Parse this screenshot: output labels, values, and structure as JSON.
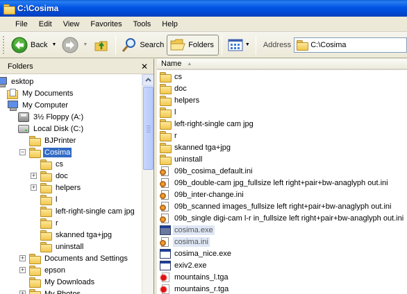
{
  "window": {
    "title": "C:\\Cosima"
  },
  "menu": [
    "File",
    "Edit",
    "View",
    "Favorites",
    "Tools",
    "Help"
  ],
  "toolbar": {
    "back_label": "Back",
    "search_label": "Search",
    "folders_label": "Folders",
    "address_label": "Address",
    "address_value": "C:\\Cosima"
  },
  "folders_pane": {
    "title": "Folders",
    "tree": [
      {
        "label": "esktop",
        "icon": "desktop-icon",
        "expander": "",
        "selected": false
      },
      {
        "label": "My Documents",
        "icon": "my-documents-icon",
        "expander": "",
        "selected": false
      },
      {
        "label": "My Computer",
        "icon": "my-computer-icon",
        "expander": "",
        "selected": false
      },
      {
        "label": "3½ Floppy (A:)",
        "icon": "floppy-drive-icon",
        "expander": "",
        "selected": false
      },
      {
        "label": "Local Disk (C:)",
        "icon": "hard-drive-icon",
        "expander": "",
        "selected": false
      },
      {
        "label": "BJPrinter",
        "icon": "folder-icon",
        "expander": "",
        "selected": false
      },
      {
        "label": "Cosima",
        "icon": "folder-open-icon",
        "expander": "−",
        "selected": true
      },
      {
        "label": "cs",
        "icon": "folder-icon",
        "expander": "",
        "selected": false
      },
      {
        "label": "doc",
        "icon": "folder-icon",
        "expander": "+",
        "selected": false
      },
      {
        "label": "helpers",
        "icon": "folder-icon",
        "expander": "+",
        "selected": false
      },
      {
        "label": "l",
        "icon": "folder-icon",
        "expander": "",
        "selected": false
      },
      {
        "label": "left-right-single cam jpg",
        "icon": "folder-icon",
        "expander": "",
        "selected": false
      },
      {
        "label": "r",
        "icon": "folder-icon",
        "expander": "",
        "selected": false
      },
      {
        "label": "skanned tga+jpg",
        "icon": "folder-icon",
        "expander": "",
        "selected": false
      },
      {
        "label": "uninstall",
        "icon": "folder-icon",
        "expander": "",
        "selected": false
      },
      {
        "label": "Documents and Settings",
        "icon": "folder-icon",
        "expander": "+",
        "selected": false
      },
      {
        "label": "epson",
        "icon": "folder-icon",
        "expander": "+",
        "selected": false
      },
      {
        "label": "My Downloads",
        "icon": "folder-icon",
        "expander": "",
        "selected": false
      },
      {
        "label": "My Photos",
        "icon": "folder-icon",
        "expander": "+",
        "selected": false
      }
    ]
  },
  "file_list": {
    "column_name": "Name",
    "files": [
      {
        "name": "cs",
        "type": "folder"
      },
      {
        "name": "doc",
        "type": "folder"
      },
      {
        "name": "helpers",
        "type": "folder"
      },
      {
        "name": "l",
        "type": "folder"
      },
      {
        "name": "left-right-single cam jpg",
        "type": "folder"
      },
      {
        "name": "r",
        "type": "folder"
      },
      {
        "name": "skanned tga+jpg",
        "type": "folder"
      },
      {
        "name": "uninstall",
        "type": "folder"
      },
      {
        "name": "09b_cosima_default.ini",
        "type": "ini"
      },
      {
        "name": "09b_double-cam jpg_fullsize left right+pair+bw-anaglyph out.ini",
        "type": "ini"
      },
      {
        "name": "09b_inter-change.ini",
        "type": "ini"
      },
      {
        "name": "09b_scanned images_fullsize left right+pair+bw-anaglyph out.ini",
        "type": "ini"
      },
      {
        "name": "09b_single digi-cam l-r in_fullsize left right+pair+bw-anaglyph out.ini",
        "type": "ini"
      },
      {
        "name": "cosima.exe",
        "type": "exe-drag"
      },
      {
        "name": "cosima.ini",
        "type": "ini-drag"
      },
      {
        "name": "cosima_nice.exe",
        "type": "exe"
      },
      {
        "name": "exiv2.exe",
        "type": "exe"
      },
      {
        "name": "mountains_l.tga",
        "type": "tga"
      },
      {
        "name": "mountains_r.tga",
        "type": "tga"
      }
    ]
  }
}
